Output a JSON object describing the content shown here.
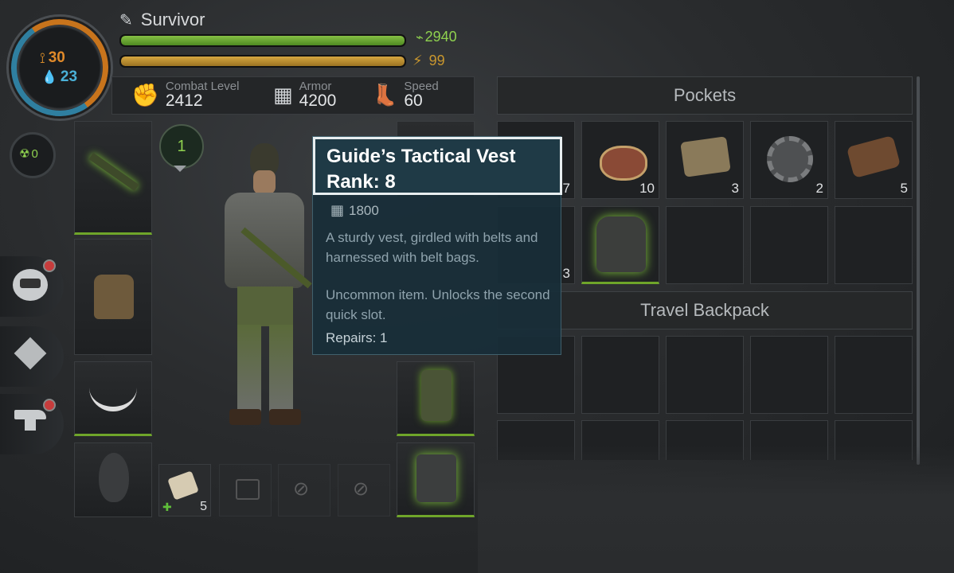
{
  "player": {
    "name": "Survivor",
    "health_value": "2940",
    "energy_value": "99",
    "health_fill": 1.0,
    "energy_fill": 1.0,
    "food_value": "30",
    "water_value": "23",
    "radiation_value": "0"
  },
  "stats": {
    "combat_label": "Combat Level",
    "combat_value": "2412",
    "armor_label": "Armor",
    "armor_value": "4200",
    "speed_label": "Speed",
    "speed_value": "60"
  },
  "level_badge": "1",
  "tooltip": {
    "title": "Guide’s Tactical Vest",
    "rank": "Rank: 8",
    "armor_value": "1800",
    "description": "A sturdy vest, girdled with belts and harnessed with belt bags.",
    "rarity": "Uncommon item. Unlocks the second quick slot.",
    "repairs": "Repairs: 1"
  },
  "pockets": {
    "title": "Pockets",
    "counts": [
      "7",
      "10",
      "3",
      "2",
      "5",
      "3"
    ]
  },
  "backpack": {
    "title": "Travel Backpack"
  },
  "quick_slots": {
    "bandage_count": "5"
  },
  "colors": {
    "health": "#5d9a2a",
    "energy": "#b48a28",
    "accent_green": "#8fd14f",
    "tooltip_bg": "#1f3a46"
  }
}
